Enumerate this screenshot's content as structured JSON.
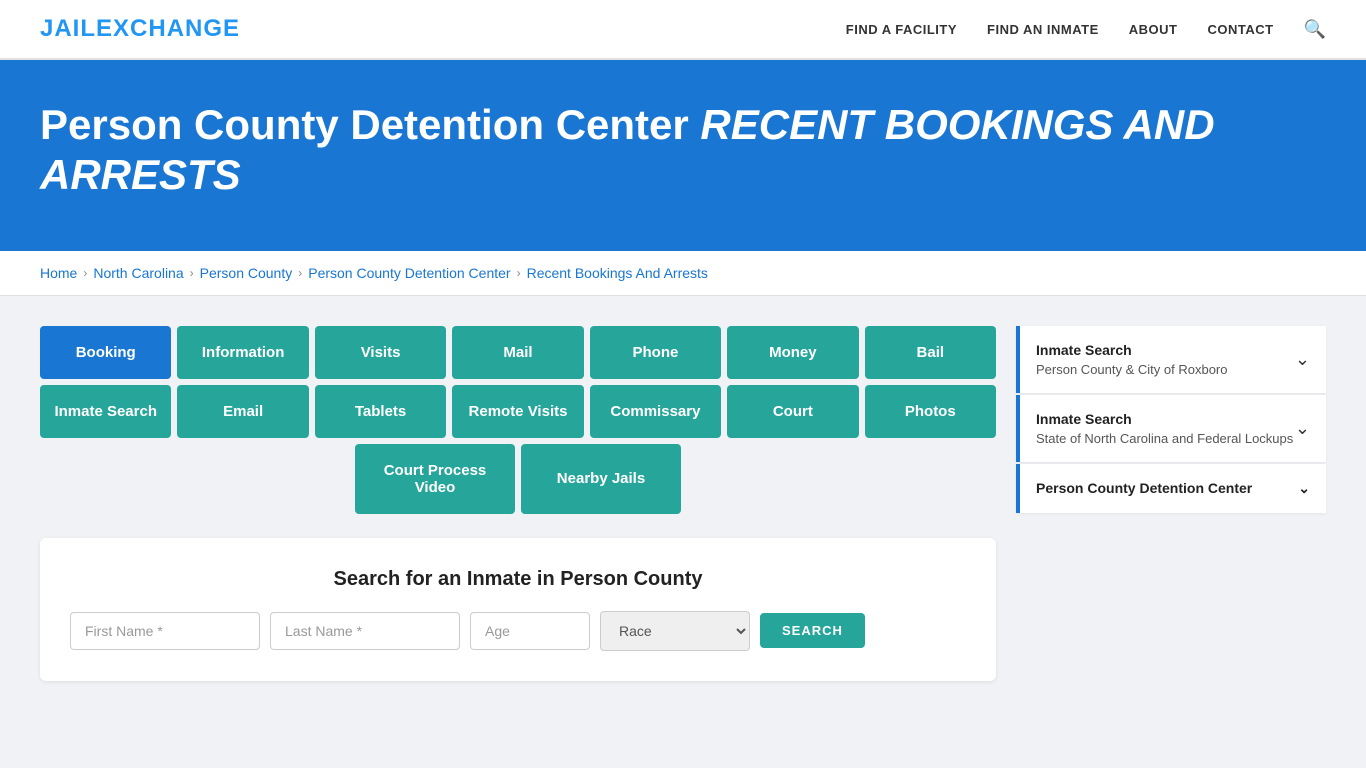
{
  "header": {
    "logo_jail": "JAIL",
    "logo_exchange": "EXCHANGE",
    "nav": [
      {
        "label": "FIND A FACILITY",
        "href": "#"
      },
      {
        "label": "FIND AN INMATE",
        "href": "#"
      },
      {
        "label": "ABOUT",
        "href": "#"
      },
      {
        "label": "CONTACT",
        "href": "#"
      }
    ]
  },
  "hero": {
    "title_main": "Person County Detention Center",
    "title_italic": "RECENT BOOKINGS AND ARRESTS"
  },
  "breadcrumb": {
    "items": [
      {
        "label": "Home",
        "href": "#"
      },
      {
        "label": "North Carolina",
        "href": "#"
      },
      {
        "label": "Person County",
        "href": "#"
      },
      {
        "label": "Person County Detention Center",
        "href": "#"
      },
      {
        "label": "Recent Bookings And Arrests",
        "href": "#"
      }
    ]
  },
  "buttons": {
    "row1": [
      {
        "label": "Booking",
        "active": true
      },
      {
        "label": "Information",
        "active": false
      },
      {
        "label": "Visits",
        "active": false
      },
      {
        "label": "Mail",
        "active": false
      },
      {
        "label": "Phone",
        "active": false
      },
      {
        "label": "Money",
        "active": false
      },
      {
        "label": "Bail",
        "active": false
      }
    ],
    "row2": [
      {
        "label": "Inmate Search",
        "active": false
      },
      {
        "label": "Email",
        "active": false
      },
      {
        "label": "Tablets",
        "active": false
      },
      {
        "label": "Remote Visits",
        "active": false
      },
      {
        "label": "Commissary",
        "active": false
      },
      {
        "label": "Court",
        "active": false
      },
      {
        "label": "Photos",
        "active": false
      }
    ],
    "row3": [
      {
        "label": "Court Process Video"
      },
      {
        "label": "Nearby Jails"
      }
    ]
  },
  "search_section": {
    "title": "Search for an Inmate in Person County",
    "first_name_placeholder": "First Name *",
    "last_name_placeholder": "Last Name *",
    "age_placeholder": "Age",
    "race_placeholder": "Race",
    "search_button": "SEARCH"
  },
  "sidebar": {
    "items": [
      {
        "title": "Inmate Search",
        "subtitle": "Person County & City of Roxboro",
        "has_chevron": true
      },
      {
        "title": "Inmate Search",
        "subtitle": "State of North Carolina and Federal Lockups",
        "has_chevron": true
      },
      {
        "title": "Person County Detention Center",
        "subtitle": "",
        "has_chevron": true
      }
    ]
  }
}
